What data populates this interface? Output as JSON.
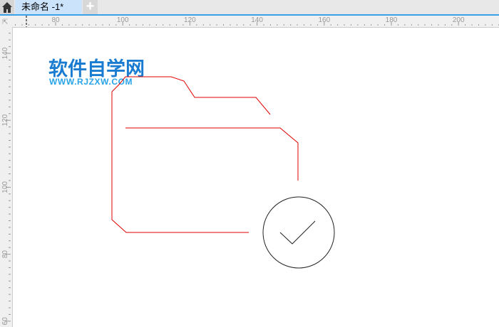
{
  "tabs": [
    {
      "label": "未命名 -1*"
    }
  ],
  "rulers": {
    "top_labels": [
      "80",
      "100",
      "120",
      "140",
      "160",
      "180",
      "200"
    ],
    "left_labels": [
      "140",
      "120",
      "100",
      "80",
      "60"
    ]
  },
  "watermark": {
    "title": "软件自学网",
    "url": "WWW.RJZXW.COM"
  },
  "colors": {
    "accent": "#3aa0e8",
    "stroke": "#e00000",
    "watermark": "#1a7cd0"
  }
}
